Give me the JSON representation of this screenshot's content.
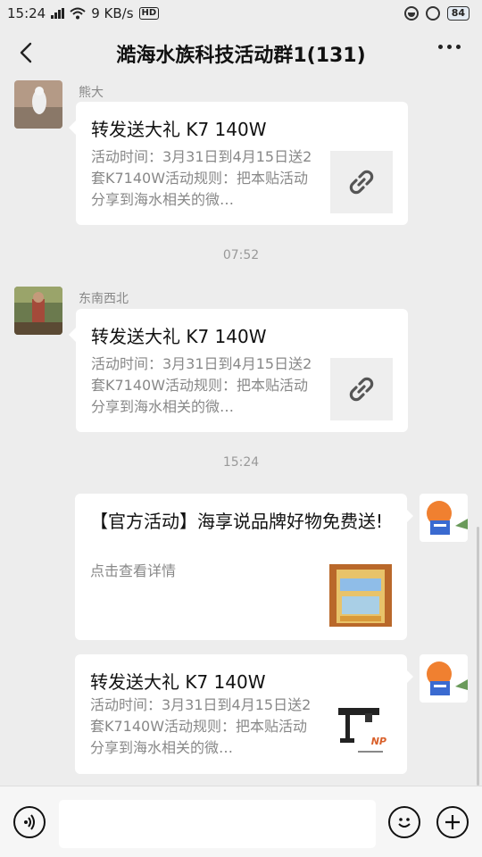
{
  "status_bar": {
    "time": "15:24",
    "net_speed": "9 KB/s",
    "hd_badge": "HD",
    "battery": "84"
  },
  "header": {
    "title": "澔海水族科技活动群1(131)",
    "back_icon": "back-arrow-icon",
    "more_icon": "more-dots-icon"
  },
  "messages": [
    {
      "sender": "熊大",
      "card": {
        "title": "转发送大礼 K7 140W",
        "desc": "活动时间：3月31日到4月15日送2套K7140W活动规则：把本贴活动分享到海水相关的微…",
        "thumb_icon": "link-icon"
      }
    },
    {
      "sender": "东南西北",
      "card": {
        "title": "转发送大礼 K7 140W",
        "desc": "活动时间：3月31日到4月15日送2套K7140W活动规则：把本贴活动分享到海水相关的微…",
        "thumb_icon": "link-icon"
      }
    },
    {
      "sender": "",
      "card": {
        "title": "【官方活动】海享说品牌好物免费送!",
        "desc": "点击查看详情",
        "thumb_icon": "product-image-icon"
      }
    },
    {
      "sender": "",
      "card": {
        "title": "转发送大礼 K7 140W",
        "desc": "活动时间：3月31日到4月15日送2套K7140W活动规则：把本贴活动分享到海水相关的微…",
        "thumb_icon": "lamp-image-icon",
        "thumb_text": "NP"
      }
    }
  ],
  "timestamps": [
    "07:52",
    "15:24"
  ],
  "input_bar": {
    "placeholder": "",
    "voice_icon": "voice-icon",
    "emoji_icon": "emoji-icon",
    "plus_icon": "plus-icon"
  },
  "colors": {
    "background": "#ededed",
    "bubble": "#ffffff",
    "link_icon": "#555555",
    "lamp_brand": "#d9602a"
  }
}
